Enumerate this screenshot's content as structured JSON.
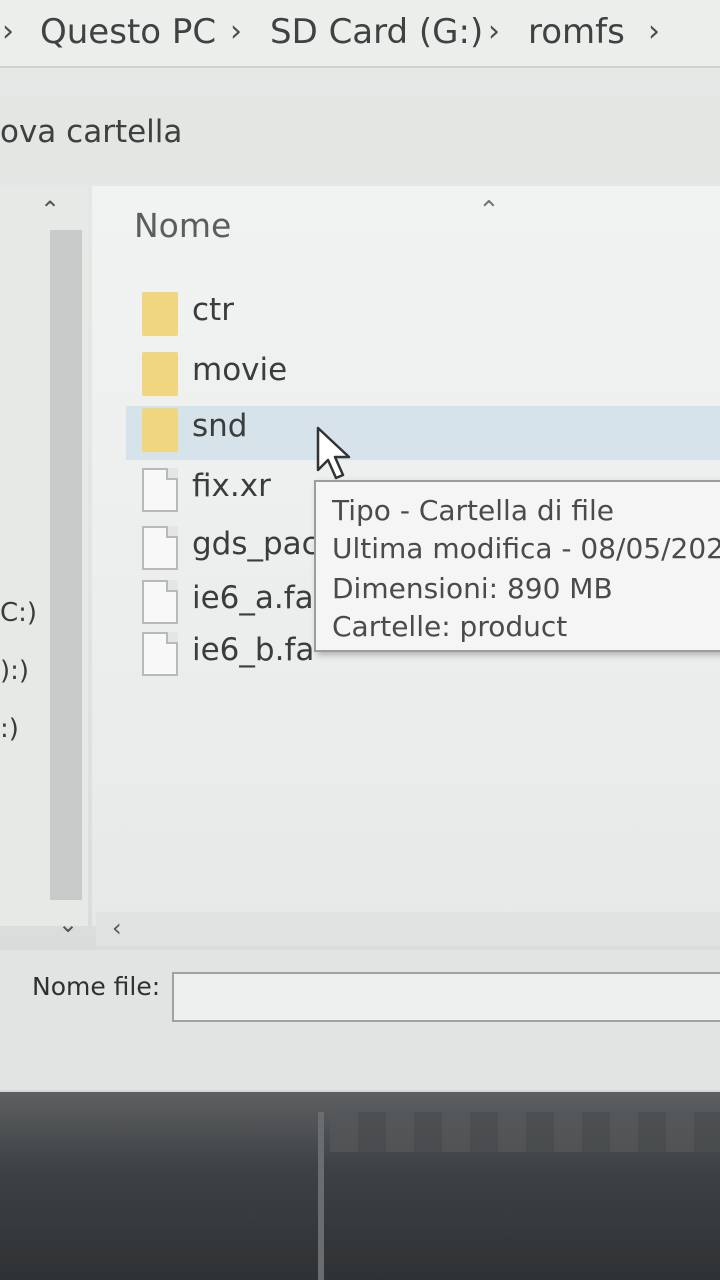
{
  "breadcrumb": {
    "items": [
      "Questo PC",
      "SD Card (G:)",
      "romfs"
    ]
  },
  "toolbar": {
    "new_folder_label": "ova cartella"
  },
  "nav_pane": {
    "drives": [
      "C:)",
      "):)",
      ":)"
    ]
  },
  "file_list": {
    "column_header": "Nome",
    "items": [
      {
        "name": "ctr",
        "type": "folder"
      },
      {
        "name": "movie",
        "type": "folder"
      },
      {
        "name": "snd",
        "type": "folder"
      },
      {
        "name": "fix.xr",
        "type": "file"
      },
      {
        "name": "gds_pack",
        "type": "file"
      },
      {
        "name": "ie6_a.fa",
        "type": "file"
      },
      {
        "name": "ie6_b.fa",
        "type": "file"
      }
    ]
  },
  "tooltip": {
    "lines": [
      "Tipo - Cartella di file",
      "Ultima modifica - 08/05/202",
      "Dimensioni: 890 MB",
      "Cartelle: product"
    ]
  },
  "filename": {
    "label": "Nome file:",
    "value": ""
  },
  "colors": {
    "folder": "#f0d67e",
    "hover_row": "#d6e3ea"
  }
}
